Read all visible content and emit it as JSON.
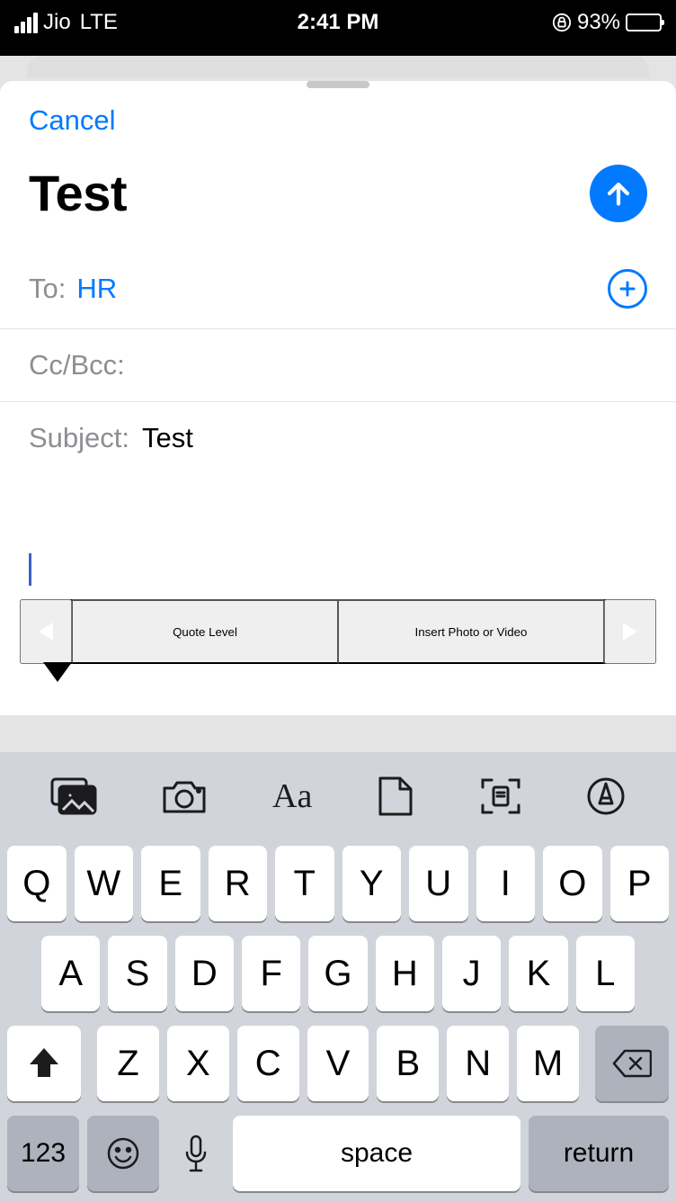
{
  "status": {
    "carrier": "Jio",
    "network": "LTE",
    "time": "2:41 PM",
    "battery_pct": "93%"
  },
  "compose": {
    "cancel": "Cancel",
    "title": "Test",
    "to_label": "To:",
    "to_value": "HR",
    "ccbcc_label": "Cc/Bcc:",
    "subject_label": "Subject:",
    "subject_value": "Test"
  },
  "context_menu": {
    "item1": "Quote Level",
    "item2": "Insert Photo or Video"
  },
  "keyboard": {
    "row1": [
      "Q",
      "W",
      "E",
      "R",
      "T",
      "Y",
      "U",
      "I",
      "O",
      "P"
    ],
    "row2": [
      "A",
      "S",
      "D",
      "F",
      "G",
      "H",
      "J",
      "K",
      "L"
    ],
    "row3": [
      "Z",
      "X",
      "C",
      "V",
      "B",
      "N",
      "M"
    ],
    "num": "123",
    "space": "space",
    "return": "return"
  }
}
